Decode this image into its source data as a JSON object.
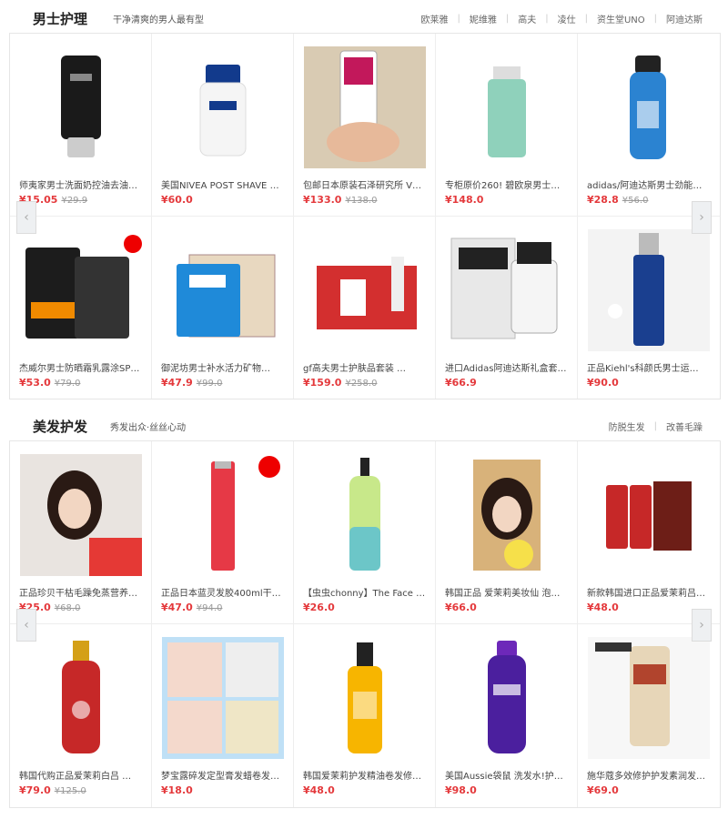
{
  "sections": [
    {
      "title": "男士护理",
      "subtitle": "干净清爽的男人最有型",
      "brands": [
        "欧莱雅",
        "妮维雅",
        "高夫",
        "凌仕",
        "资生堂UNO",
        "阿迪达斯"
      ],
      "products": [
        {
          "name": "师夷家男士洗面奶控油去油…",
          "price": "¥15.05",
          "old": "¥29.9",
          "icon": "black-tube"
        },
        {
          "name": "美国NIVEA POST SHAVE BAL…",
          "price": "¥60.0",
          "old": "",
          "icon": "nivea-bottle"
        },
        {
          "name": "包邮日本原装石泽研究所 V…",
          "price": "¥133.0",
          "old": "¥138.0",
          "icon": "hand-bottle"
        },
        {
          "name": "专柜原价260! 碧欧泉男士…",
          "price": "¥148.0",
          "old": "",
          "icon": "green-bottle"
        },
        {
          "name": "adidas/阿迪达斯男士劲能香波沐浴…",
          "price": "¥28.8",
          "old": "¥56.0",
          "icon": "blue-bottle"
        },
        {
          "name": "杰威尔男士防晒霜乳露涂SP…",
          "price": "¥53.0",
          "old": "¥79.0",
          "icon": "jvr-set"
        },
        {
          "name": "御泥坊男士补水活力矿物…",
          "price": "¥47.9",
          "old": "¥99.0",
          "icon": "mask-box"
        },
        {
          "name": "gf高夫男士护肤品套装 …",
          "price": "¥159.0",
          "old": "¥258.0",
          "icon": "red-set"
        },
        {
          "name": "进口Adidas阿迪达斯礼盒套…",
          "price": "¥66.9",
          "old": "",
          "icon": "adidas-box"
        },
        {
          "name": "正品Kiehl's科颜氏男士运…",
          "price": "¥90.0",
          "old": "",
          "icon": "kiehls-bottle"
        }
      ]
    },
    {
      "title": "美发护发",
      "subtitle": "秀发出众·丝丝心动",
      "brands": [
        "防脱生发",
        "改善毛躁"
      ],
      "products": [
        {
          "name": "正品珍贝干枯毛躁免蒸营养…",
          "price": "¥25.0",
          "old": "¥68.0",
          "icon": "girl-photo"
        },
        {
          "name": "正品日本蓝灵发胶400ml干…",
          "price": "¥47.0",
          "old": "¥94.0",
          "icon": "red-spray"
        },
        {
          "name": "【虫虫chonny】The Face S…",
          "price": "¥26.0",
          "old": "",
          "icon": "green-pump"
        },
        {
          "name": "韩国正品 爱茉莉美妆仙 泡…",
          "price": "¥66.0",
          "old": "",
          "icon": "hair-dye"
        },
        {
          "name": "新款韩国进口正品爱茉莉吕…",
          "price": "¥48.0",
          "old": "",
          "icon": "ryo-set"
        },
        {
          "name": "韩国代购正品爱茉莉白吕 …",
          "price": "¥79.0",
          "old": "¥125.0",
          "icon": "red-pump"
        },
        {
          "name": "梦宝露碎发定型膏发蜡卷发…",
          "price": "¥18.0",
          "old": "",
          "icon": "collage"
        },
        {
          "name": "韩国爱茉莉护发精油卷发修…",
          "price": "¥48.0",
          "old": "",
          "icon": "oil-bottle"
        },
        {
          "name": "美国Aussie袋鼠 洗发水!护…",
          "price": "¥98.0",
          "old": "",
          "icon": "aussie-bottle"
        },
        {
          "name": "施华蔻多效修护护发素润发…",
          "price": "¥69.0",
          "old": "",
          "icon": "schwarzkopf-tube"
        }
      ]
    }
  ]
}
